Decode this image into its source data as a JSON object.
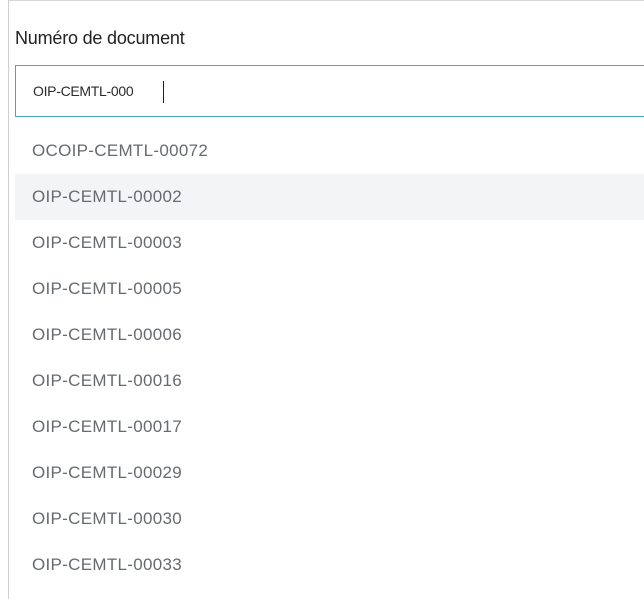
{
  "field": {
    "label": "Numéro de document",
    "value": "OIP-CEMTL-000"
  },
  "dropdown": {
    "highlighted_index": 1,
    "options": [
      "OCOIP-CEMTL-00072",
      "OIP-CEMTL-00002",
      "OIP-CEMTL-00003",
      "OIP-CEMTL-00005",
      "OIP-CEMTL-00006",
      "OIP-CEMTL-00016",
      "OIP-CEMTL-00017",
      "OIP-CEMTL-00029",
      "OIP-CEMTL-00030",
      "OIP-CEMTL-00033"
    ]
  },
  "colors": {
    "input_border": "#4aa3c7",
    "option_text": "#666b70",
    "highlight_bg": "#f2f4f6"
  }
}
